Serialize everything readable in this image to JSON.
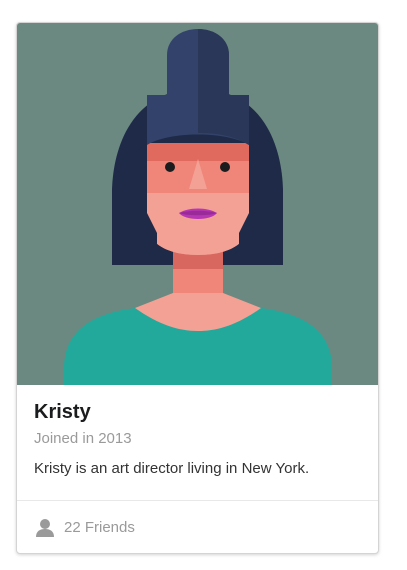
{
  "card": {
    "name": "Kristy",
    "meta": "Joined in 2013",
    "description": "Kristy is an art director living in New York.",
    "friends_label": "22 Friends"
  },
  "icons": {
    "friends": "user-icon"
  },
  "colors": {
    "image_background": "#6b8980",
    "hair": "#1e2a47",
    "skin": "#f0857a",
    "shirt": "#23a99c",
    "lips": "#b637b5",
    "meta_text": "#9a9a9a"
  }
}
